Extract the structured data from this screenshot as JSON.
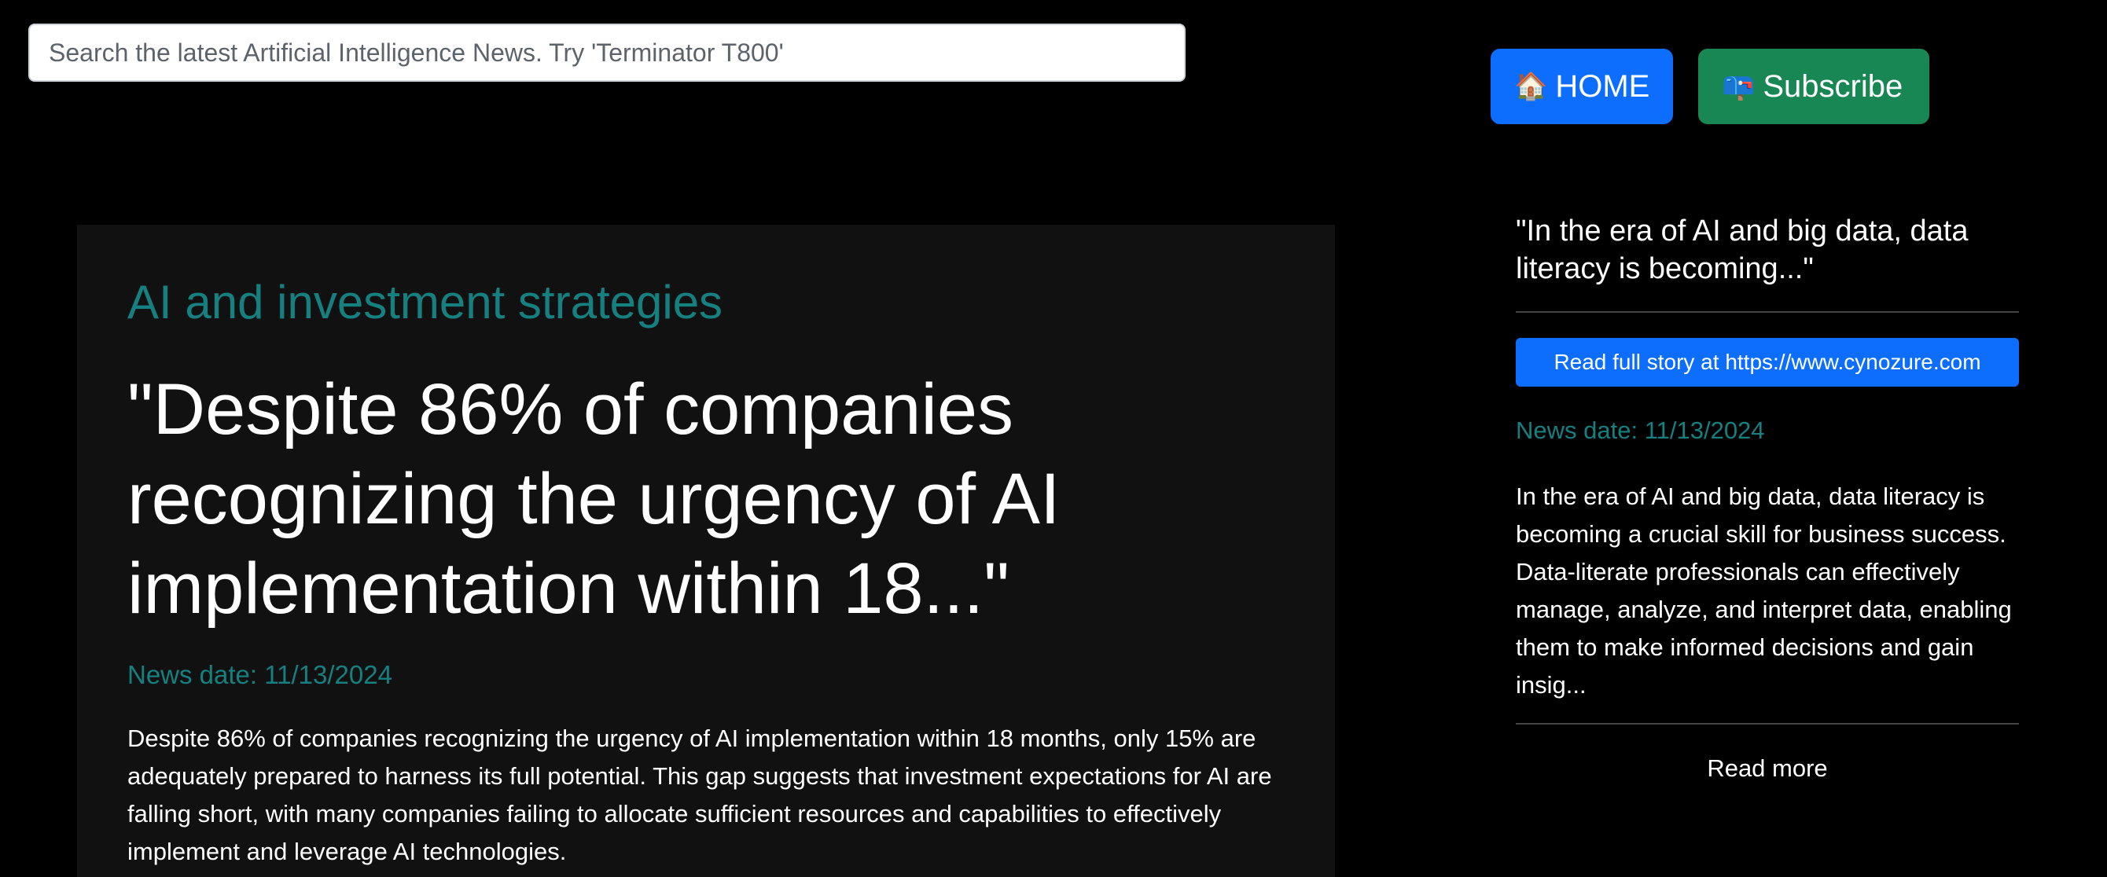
{
  "search": {
    "placeholder": "Search the latest Artificial Intelligence News. Try 'Terminator T800'"
  },
  "nav": {
    "home_icon": "🏠",
    "home_label": "HOME",
    "subscribe_icon": "📪",
    "subscribe_label": "Subscribe",
    "home_color": "#0d6efd",
    "subscribe_color": "#198754"
  },
  "main_article": {
    "category": "AI and investment strategies",
    "headline": "\"Despite 86% of companies recognizing the urgency of AI implementation within 18...\"",
    "news_date": "News date: 11/13/2024",
    "summary": "Despite 86% of companies recognizing the urgency of AI implementation within 18 months, only 15% are adequately prepared to harness its full potential. This gap suggests that investment expectations for AI are falling short, with many companies failing to allocate sufficient resources and capabilities to effectively implement and leverage AI technologies."
  },
  "side_article": {
    "title": "\"In the era of AI and big data, data literacy is becoming...\"",
    "read_full_label": "Read full story at https://www.cynozure.com",
    "news_date": "News date: 11/13/2024",
    "summary": "In the era of AI and big data, data literacy is becoming a crucial skill for business success. Data-literate professionals can effectively manage, analyze, and interpret data, enabling them to make informed decisions and gain insig...",
    "read_more_label": "Read more"
  },
  "colors": {
    "background": "#000000",
    "card": "#111111",
    "accent_teal": "#168080"
  }
}
